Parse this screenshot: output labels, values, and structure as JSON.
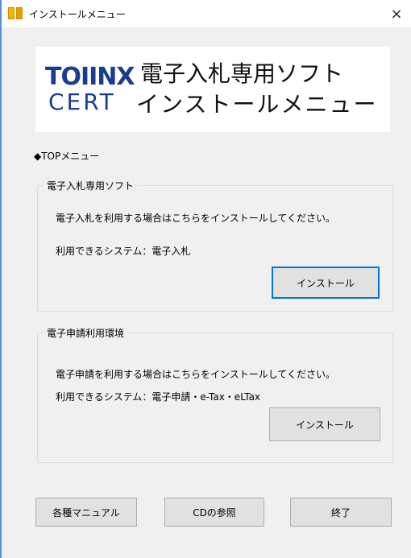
{
  "window": {
    "title": "インストールメニュー",
    "close_label": "×"
  },
  "banner": {
    "logo_line1": "TOIINX",
    "logo_line2": "CERT",
    "title": "電子入札専用ソフト",
    "subtitle": "インストールメニュー"
  },
  "top_menu_label": "◆TOPメニュー",
  "sections": [
    {
      "label": "電子入札専用ソフト",
      "description": "電子入札を利用する場合はこちらをインストールしてください。",
      "systems": "利用できるシステム：電子入札",
      "install_label": "インストール"
    },
    {
      "label": "電子申請利用環境",
      "description": "電子申請を利用する場合はこちらをインストールしてください。",
      "systems": "利用できるシステム：電子申請・e-Tax・eLTax",
      "install_label": "インストール"
    }
  ],
  "footer": {
    "manuals_label": "各種マニュアル",
    "cd_label": "CDの参照",
    "exit_label": "終了"
  },
  "colors": {
    "logo": "#1a3d91",
    "focus_border": "#0078d7",
    "window_bg": "#f0f0f0"
  }
}
